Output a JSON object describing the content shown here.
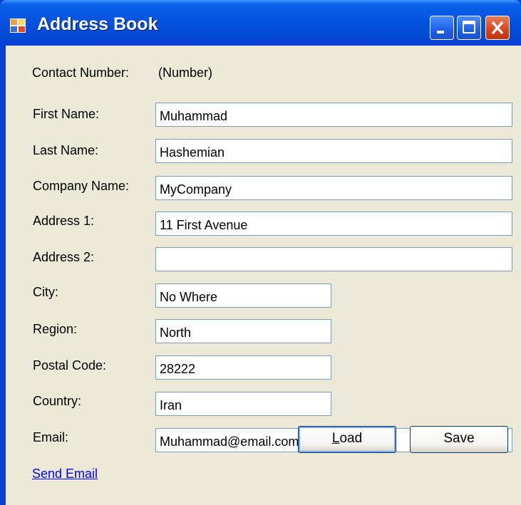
{
  "window": {
    "title": "Address Book"
  },
  "contact": {
    "label": "Contact Number:",
    "value": "(Number)"
  },
  "form": {
    "first_name": {
      "label": "First Name:",
      "value": "Muhammad"
    },
    "last_name": {
      "label": "Last Name:",
      "value": "Hashemian"
    },
    "company_name": {
      "label": "Company Name:",
      "value": "MyCompany"
    },
    "address1": {
      "label": "Address 1:",
      "value": "11 First Avenue"
    },
    "address2": {
      "label": "Address 2:",
      "value": ""
    },
    "city": {
      "label": "City:",
      "value": "No Where"
    },
    "region": {
      "label": "Region:",
      "value": "North"
    },
    "postal_code": {
      "label": "Postal Code:",
      "value": "28222"
    },
    "country": {
      "label": "Country:",
      "value": "Iran"
    },
    "email": {
      "label": "Email:",
      "value": "Muhammad@email.com"
    }
  },
  "actions": {
    "send_email": "Send Email",
    "load_mnemonic": "L",
    "load_rest": "oad",
    "save": "Save"
  },
  "icons": {
    "app": "app-window-icon",
    "minimize": "minimize-icon",
    "maximize": "maximize-icon",
    "close": "close-icon"
  },
  "colors": {
    "titlebar": "#0553e1",
    "client": "#ece9d8",
    "field_border": "#7f9db9",
    "close_button": "#d4441c",
    "link": "#0000ff"
  }
}
